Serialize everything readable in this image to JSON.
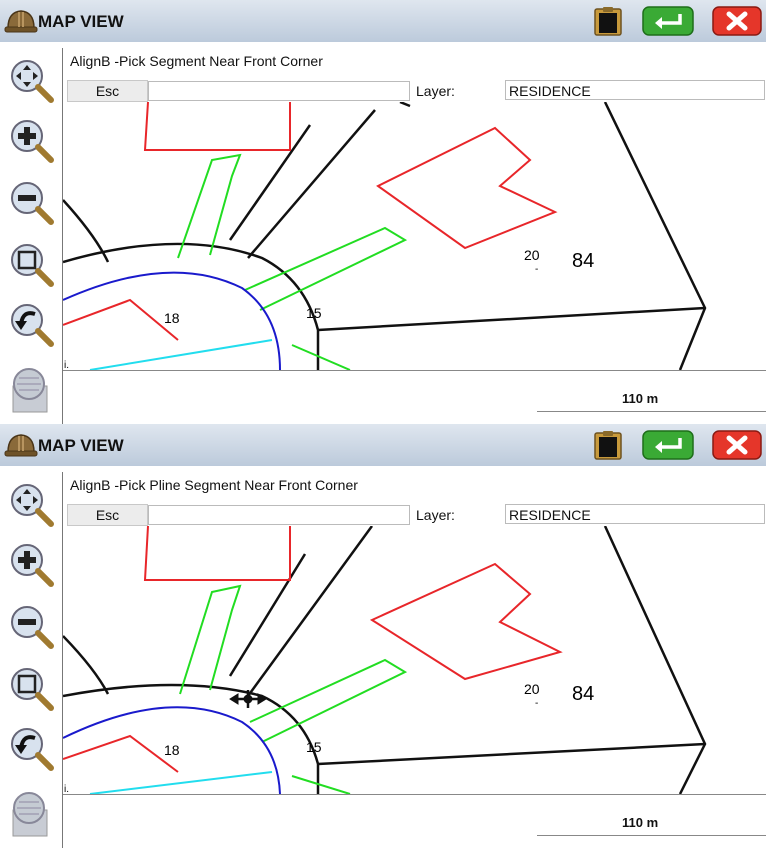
{
  "panels": [
    {
      "title": "MAP VIEW",
      "prompt": "AlignB  -Pick Segment Near Front Corner",
      "esc_label": "Esc",
      "command_value": "",
      "layer_label": "Layer:",
      "layer_value": "RESIDENCE",
      "scale": "110 m",
      "map_labels": {
        "pt18": "18",
        "pt15": "15",
        "pt20": "20",
        "lot84": "84",
        "pt_small": "i."
      }
    },
    {
      "title": "MAP VIEW",
      "prompt": "AlignB  -Pick Pline Segment Near Front Corner",
      "esc_label": "Esc",
      "command_value": "",
      "layer_label": "Layer:",
      "layer_value": "RESIDENCE",
      "scale": "110 m",
      "map_labels": {
        "pt18": "18",
        "pt15": "15",
        "pt20": "20",
        "lot84": "84",
        "pt_small": "i."
      }
    }
  ],
  "tools": [
    "pan-zoom-icon",
    "zoom-in-icon",
    "zoom-out-icon",
    "zoom-window-icon",
    "zoom-previous-icon",
    "zoom-layers-icon"
  ],
  "colors": {
    "titlebar_top": "#dfe6ef",
    "red_line": "#e8262a",
    "green_line": "#22dd22",
    "blue_line": "#1a1acc",
    "cyan_line": "#22ddee",
    "close_red": "#e5362a",
    "enter_green": "#3aaa35"
  }
}
